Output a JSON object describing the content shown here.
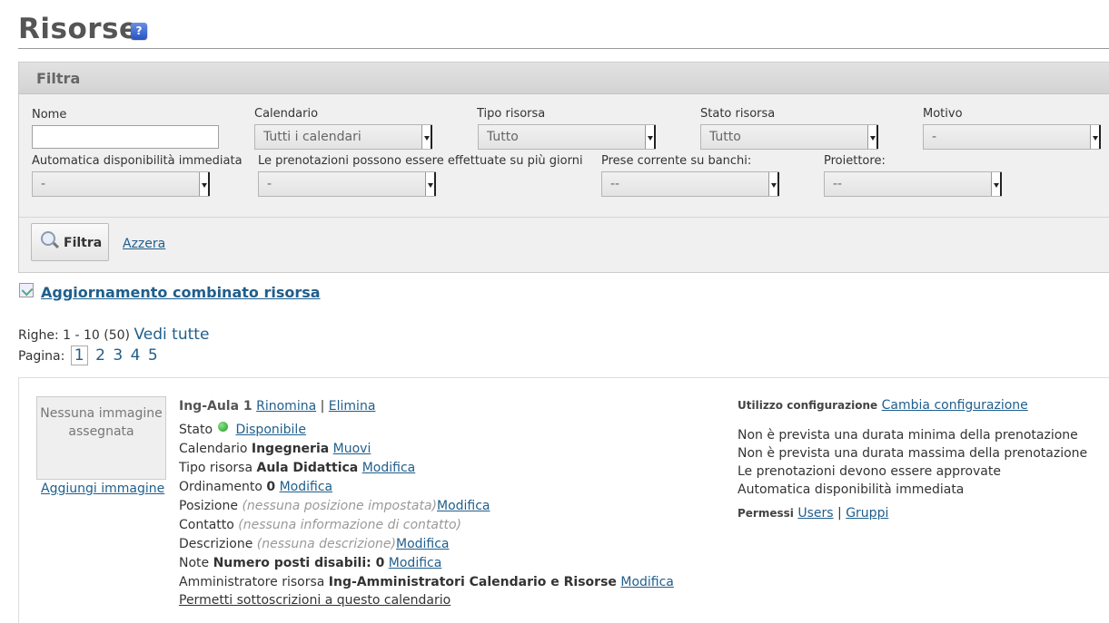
{
  "page": {
    "title": "Risorse",
    "help_icon": "?"
  },
  "filter": {
    "heading": "Filtra",
    "name_label": "Nome",
    "name_value": "",
    "calendar_label": "Calendario",
    "calendar_value": "Tutti i calendari",
    "type_label": "Tipo risorsa",
    "type_value": "Tutto",
    "status_label": "Stato risorsa",
    "status_value": "Tutto",
    "reason_label": "Motivo",
    "reason_value": "-",
    "auto_label": "Automatica disponibilità immediata",
    "auto_value": "-",
    "multiday_label": "Le prenotazioni possono essere effettuate su più giorni",
    "multiday_value": "-",
    "power_label": "Prese corrente su banchi:",
    "power_value": "--",
    "projector_label": "Proiettore:",
    "projector_value": "--",
    "button_label": "Filtra",
    "reset_label": "Azzera"
  },
  "combined_update": "Aggiornamento combinato risorsa",
  "pagination": {
    "rows_label": "Righe: 1 - 10 (50)",
    "view_all": "Vedi tutte",
    "page_label": "Pagina:",
    "pages": [
      "1",
      "2",
      "3",
      "4",
      "5"
    ]
  },
  "resource": {
    "no_image": "Nessuna immagine assegnata",
    "add_image": "Aggiungi immagine",
    "name": "Ing-Aula 1",
    "rename": "Rinomina",
    "delete": "Elimina",
    "separator": "|",
    "status_label": "Stato",
    "status_value": "Disponibile",
    "calendar_label": "Calendario",
    "calendar_value": "Ingegneria",
    "move": "Muovi",
    "type_label": "Tipo risorsa",
    "type_value": "Aula Didattica",
    "edit": "Modifica",
    "order_label": "Ordinamento",
    "order_value": "0",
    "position_label": "Posizione",
    "position_value": "(nessuna posizione impostata)",
    "contact_label": "Contatto",
    "contact_value": "(nessuna informazione di contatto)",
    "description_label": "Descrizione",
    "description_value": "(nessuna descrizione)",
    "notes_label": "Note",
    "notes_value": "Numero posti disabili: 0",
    "admin_label": "Amministratore risorsa",
    "admin_value": "Ing-Amministratori Calendario e Risorse",
    "subscribe": "Permetti sottoscrizioni a questo calendario",
    "config_label": "Utilizzo configurazione",
    "config_change": "Cambia configurazione",
    "rules": [
      "Non è prevista una durata minima della prenotazione",
      "Non è prevista una durata massima della prenotazione",
      "Le prenotazioni devono essere approvate",
      "Automatica disponibilità immediata"
    ],
    "permissions_label": "Permessi",
    "users": "Users",
    "groups": "Gruppi"
  }
}
